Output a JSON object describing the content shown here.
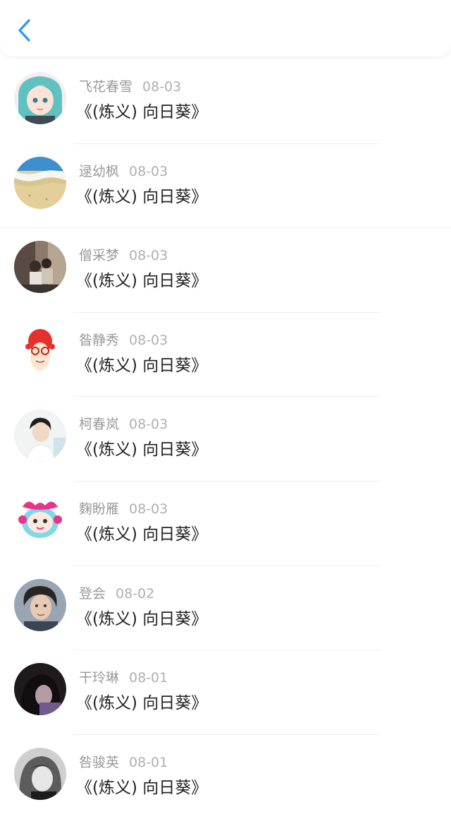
{
  "header": {
    "back_icon": "chevron-left-icon",
    "accent_color": "#2b9bf0"
  },
  "items": [
    {
      "name": "飞花春雪",
      "date": "08-03",
      "title": "《(炼义) 向日葵》",
      "avatar": "anime-girl-teal-hair"
    },
    {
      "name": "逯幼枫",
      "date": "08-03",
      "title": "《(炼义) 向日葵》",
      "avatar": "beach-sand-ocean"
    },
    {
      "name": "僧采梦",
      "date": "08-03",
      "title": "《(炼义) 向日葵》",
      "avatar": "couple-photo"
    },
    {
      "name": "昝静秀",
      "date": "08-03",
      "title": "《(炼义) 向日葵》",
      "avatar": "cartoon-red-hair"
    },
    {
      "name": "柯春岚",
      "date": "08-03",
      "title": "《(炼义) 向日葵》",
      "avatar": "boy-portrait"
    },
    {
      "name": "麴盼雁",
      "date": "08-03",
      "title": "《(炼义) 向日葵》",
      "avatar": "cartoon-pink-sheep"
    },
    {
      "name": "登会",
      "date": "08-02",
      "title": "《(炼义) 向日葵》",
      "avatar": "man-portrait"
    },
    {
      "name": "干玲琳",
      "date": "08-01",
      "title": "《(炼义) 向日葵》",
      "avatar": "dark-hair-girl"
    },
    {
      "name": "咎骏英",
      "date": "08-01",
      "title": "《(炼义) 向日葵》",
      "avatar": "grayscale-portrait"
    }
  ]
}
